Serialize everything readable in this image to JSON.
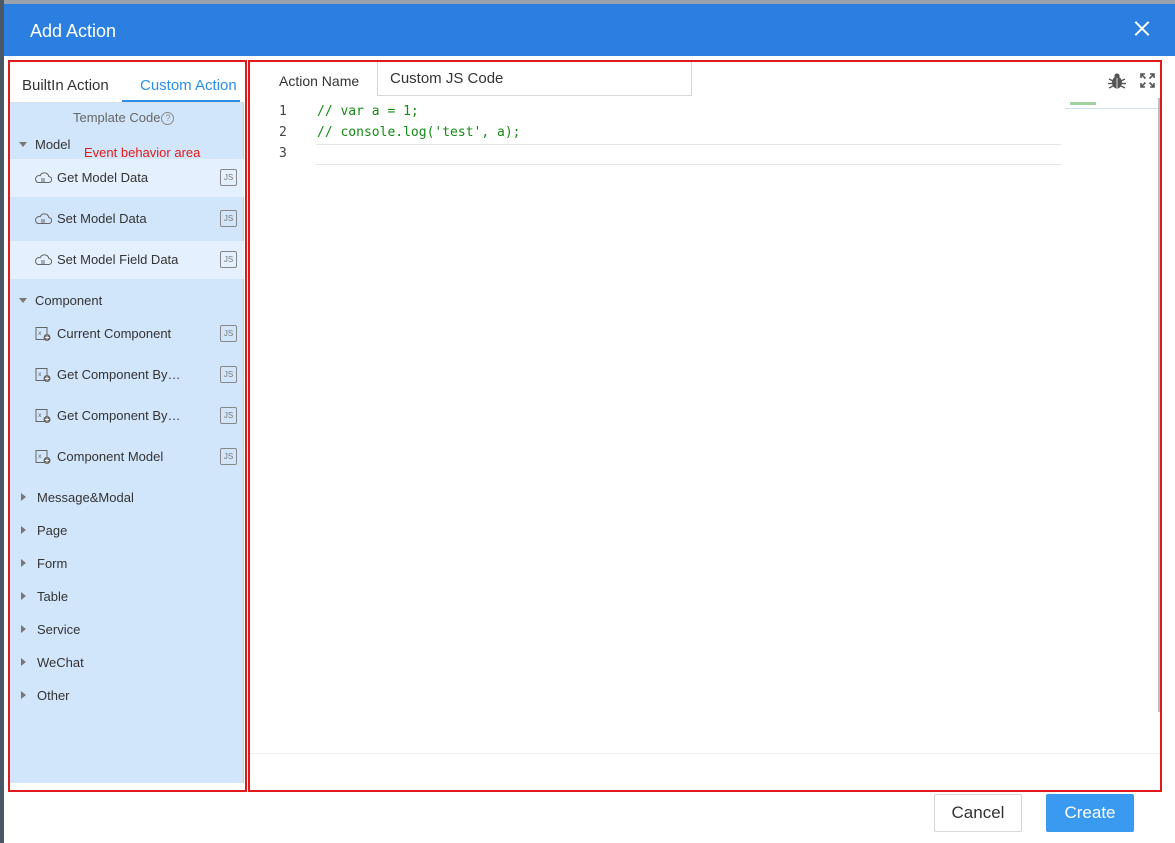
{
  "dialog": {
    "title": "Add Action"
  },
  "tabs": {
    "builtin": "BuiltIn Action",
    "custom": "Custom Action"
  },
  "template": {
    "header": "Template Code",
    "help": "?"
  },
  "annotation": "Event behavior area",
  "tree": {
    "model": {
      "label": "Model",
      "items": [
        {
          "label": "Get Model Data",
          "icon": "cloud-database-icon"
        },
        {
          "label": "Set Model Data",
          "icon": "cloud-database-icon"
        },
        {
          "label": "Set Model Field Data",
          "icon": "cloud-database-icon"
        }
      ]
    },
    "component": {
      "label": "Component",
      "items": [
        {
          "label": "Current Component",
          "icon": "component-plus-icon"
        },
        {
          "label": "Get Component By…",
          "icon": "component-plus-icon"
        },
        {
          "label": "Get Component By…",
          "icon": "component-plus-icon"
        },
        {
          "label": "Component Model",
          "icon": "component-plus-icon"
        }
      ]
    },
    "collapsed": [
      "Message&Modal",
      "Page",
      "Form",
      "Table",
      "Service",
      "WeChat",
      "Other"
    ]
  },
  "js_badge": "JS",
  "action_name": {
    "label": "Action Name",
    "value": "Custom JS Code"
  },
  "editor": {
    "lines": [
      {
        "num": "1",
        "text": "// var a = 1;"
      },
      {
        "num": "2",
        "text": "// console.log('test', a);"
      },
      {
        "num": "3",
        "text": ""
      }
    ]
  },
  "buttons": {
    "cancel": "Cancel",
    "create": "Create"
  },
  "colors": {
    "header": "#2b7fe0",
    "accent": "#2b8fe6",
    "tree_bg": "#d2e6fb",
    "outline": "#e01a1a",
    "code": "#168a16",
    "create_btn": "#3a9af0"
  }
}
